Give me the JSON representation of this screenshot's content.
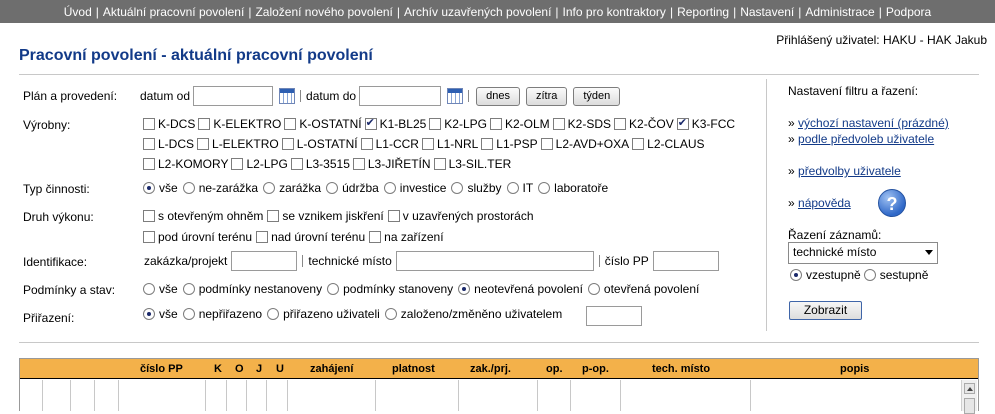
{
  "nav": [
    "Úvod",
    "Aktuální pracovní povolení",
    "Založení nového povolení",
    "Archív uzavřených povolení",
    "Info pro kontraktory",
    "Reporting",
    "Nastavení",
    "Administrace",
    "Podpora"
  ],
  "user_line": "Přihlášený uživatel: HAKU - HAK Jakub",
  "page_title": "Pracovní povolení - aktuální pracovní povolení",
  "filters": {
    "plan_label": "Plán a provedení:",
    "date_from_label": "datum od",
    "date_to_label": "datum do",
    "date_from_value": "",
    "date_to_value": "",
    "btn_today": "dnes",
    "btn_tomorrow": "zítra",
    "btn_week": "týden",
    "vyrobny_label": "Výrobny:",
    "vyrobny": [
      [
        {
          "label": "K-DCS",
          "checked": false
        },
        {
          "label": "K-ELEKTRO",
          "checked": false
        },
        {
          "label": "K-OSTATNÍ",
          "checked": false
        },
        {
          "label": "K1-BL25",
          "checked": true
        },
        {
          "label": "K2-LPG",
          "checked": false
        },
        {
          "label": "K2-OLM",
          "checked": false
        },
        {
          "label": "K2-SDS",
          "checked": false
        },
        {
          "label": "K2-ČOV",
          "checked": false
        },
        {
          "label": "K3-FCC",
          "checked": true
        }
      ],
      [
        {
          "label": "L-DCS",
          "checked": false
        },
        {
          "label": "L-ELEKTRO",
          "checked": false
        },
        {
          "label": "L-OSTATNÍ",
          "checked": false
        },
        {
          "label": "L1-CCR",
          "checked": false
        },
        {
          "label": "L1-NRL",
          "checked": false
        },
        {
          "label": "L1-PSP",
          "checked": false
        },
        {
          "label": "L2-AVD+OXA",
          "checked": false
        },
        {
          "label": "L2-CLAUS",
          "checked": false
        }
      ],
      [
        {
          "label": "L2-KOMORY",
          "checked": false
        },
        {
          "label": "L2-LPG",
          "checked": false
        },
        {
          "label": "L3-3515",
          "checked": false
        },
        {
          "label": "L3-JIŘETÍN",
          "checked": false
        },
        {
          "label": "L3-SIL.TER",
          "checked": false
        }
      ]
    ],
    "typ_label": "Typ činnosti:",
    "typ": [
      {
        "label": "vše",
        "checked": true
      },
      {
        "label": "ne-zarážka",
        "checked": false
      },
      {
        "label": "zarážka",
        "checked": false
      },
      {
        "label": "údržba",
        "checked": false
      },
      {
        "label": "investice",
        "checked": false
      },
      {
        "label": "služby",
        "checked": false
      },
      {
        "label": "IT",
        "checked": false
      },
      {
        "label": "laboratoře",
        "checked": false
      }
    ],
    "druh_label": "Druh výkonu:",
    "druh": [
      [
        {
          "label": "s otevřeným ohněm",
          "checked": false
        },
        {
          "label": "se vznikem jiskření",
          "checked": false
        },
        {
          "label": "v uzavřených prostorách",
          "checked": false
        }
      ],
      [
        {
          "label": "pod úrovní terénu",
          "checked": false
        },
        {
          "label": "nad úrovní terénu",
          "checked": false
        },
        {
          "label": "na zařízení",
          "checked": false
        }
      ]
    ],
    "ident_label": "Identifikace:",
    "zakazka_label": "zakázka/projekt",
    "techmisto_label": "technické místo",
    "cislopp_label": "číslo PP",
    "podminky_label": "Podmínky a stav:",
    "podminky": [
      {
        "label": "vše",
        "checked": false
      },
      {
        "label": "podmínky nestanoveny",
        "checked": false
      },
      {
        "label": "podmínky stanoveny",
        "checked": false
      },
      {
        "label": "neotevřená povolení",
        "checked": true
      },
      {
        "label": "otevřená povolení",
        "checked": false
      }
    ],
    "prirazeni_label": "Přiřazení:",
    "prirazeni": [
      {
        "label": "vše",
        "checked": true
      },
      {
        "label": "nepřiřazeno",
        "checked": false
      },
      {
        "label": "přiřazeno uživateli",
        "checked": false
      },
      {
        "label": "založeno/změněno uživatelem",
        "checked": false
      }
    ]
  },
  "right": {
    "heading": "Nastavení filtru a řazení:",
    "link_default": "výchozí nastavení (prázdné)",
    "link_user_prefs": "podle předvoleb uživatele",
    "link_prefs": "předvolby uživatele",
    "link_help": "nápověda",
    "sort_label": "Řazení záznamů:",
    "sort_value": "technické místo",
    "asc": "vzestupně",
    "desc": "sestupně",
    "show_button": "Zobrazit"
  },
  "table": {
    "columns": [
      "číslo PP",
      "K",
      "O",
      "J",
      "U",
      "zahájení",
      "platnost",
      "zak./prj.",
      "op.",
      "p-op.",
      "tech. místo",
      "popis"
    ]
  }
}
